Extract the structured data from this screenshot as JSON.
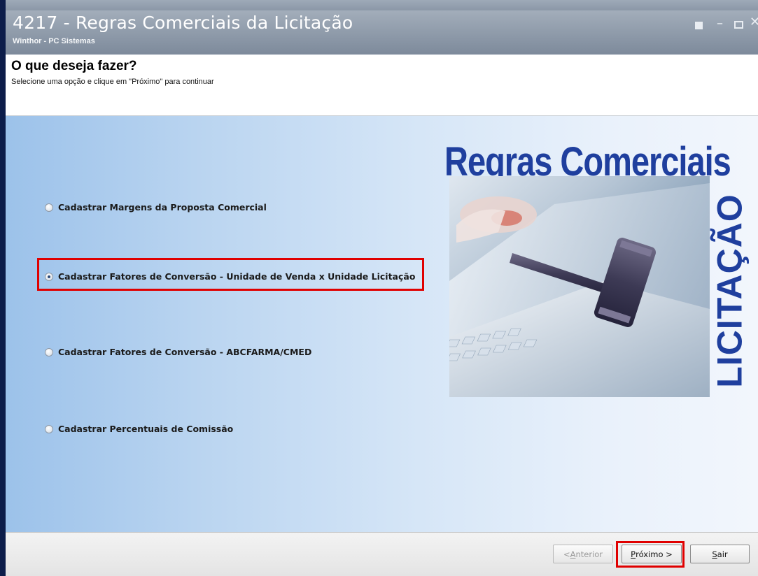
{
  "window": {
    "title": "4217 - Regras Comerciais da Licitação",
    "subtitle": "Winthor - PC Sistemas",
    "controls": [
      "restore-icon",
      "minimize-icon",
      "maximize-icon",
      "close-icon"
    ]
  },
  "header": {
    "question": "O que deseja fazer?",
    "hint": "Selecione uma opção e clique em \"Próximo\" para continuar"
  },
  "options": [
    {
      "label": "Cadastrar Margens da Proposta Comercial",
      "checked": false
    },
    {
      "label": "Cadastrar Fatores de Conversão - Unidade de Venda x Unidade Licitação",
      "checked": true
    },
    {
      "label": "Cadastrar Fatores de Conversão - ABCFARMA/CMED",
      "checked": false
    },
    {
      "label": "Cadastrar Percentuais de Comissão",
      "checked": false
    }
  ],
  "banner": {
    "title": "Regras Comerciais",
    "vertical": "LICITAÇÃO",
    "image": "gavel-keyboard-illustration"
  },
  "footer": {
    "prev_pre": "< ",
    "prev_key": "A",
    "prev_rest": "nterior",
    "next_key": "P",
    "next_rest": "róximo >",
    "exit_key": "S",
    "exit_rest": "air"
  },
  "colors": {
    "accent_blue": "#1f3f9e",
    "highlight_red": "#e00000",
    "titlebar": "#8c98a8"
  }
}
